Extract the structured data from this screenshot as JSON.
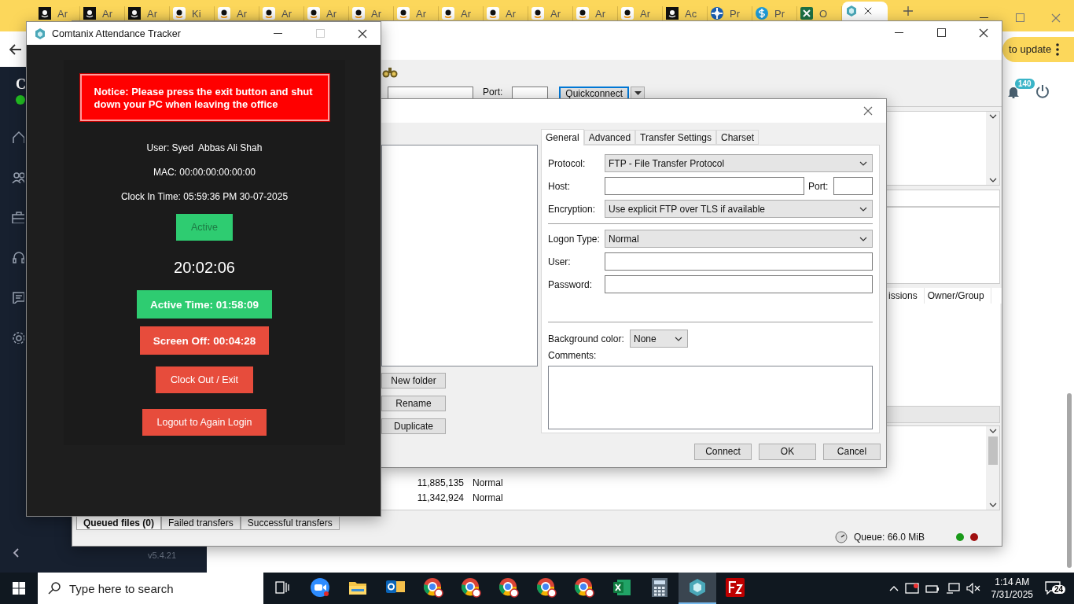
{
  "browser": {
    "tabs": [
      {
        "kind": "dark",
        "title": "Ar",
        "selected": false
      },
      {
        "kind": "dark",
        "title": "Ar",
        "selected": false
      },
      {
        "kind": "dark",
        "title": "Ar",
        "selected": false
      },
      {
        "kind": "light",
        "title": "Ki",
        "selected": false
      },
      {
        "kind": "light",
        "title": "Ar",
        "selected": false
      },
      {
        "kind": "light",
        "title": "Ar",
        "selected": false
      },
      {
        "kind": "light",
        "title": "Ar",
        "selected": false
      },
      {
        "kind": "light",
        "title": "Ar",
        "selected": false
      },
      {
        "kind": "light",
        "title": "Ar",
        "selected": false
      },
      {
        "kind": "light",
        "title": "Ar",
        "selected": false
      },
      {
        "kind": "light",
        "title": "Ar",
        "selected": false
      },
      {
        "kind": "light",
        "title": "Ar",
        "selected": false
      },
      {
        "kind": "light",
        "title": "Ar",
        "selected": false
      },
      {
        "kind": "light",
        "title": "Ar",
        "selected": false
      },
      {
        "kind": "dark",
        "title": "Ac",
        "selected": false
      },
      {
        "kind": "wheel",
        "title": "Pr",
        "selected": false
      },
      {
        "kind": "dollar",
        "title": "Pr",
        "selected": false
      },
      {
        "kind": "sheet",
        "title": "O",
        "selected": false
      },
      {
        "kind": "hex",
        "selected": true
      }
    ],
    "update_pill": "to update"
  },
  "webapp": {
    "brand": "C",
    "online": true,
    "nav": [
      {
        "kind": "home"
      },
      {
        "kind": "users"
      },
      {
        "kind": "briefcase"
      },
      {
        "kind": "headset"
      },
      {
        "kind": "message"
      },
      {
        "kind": "settings"
      }
    ],
    "notification_count": "140",
    "version": "v5.4.21"
  },
  "filezilla": {
    "quickconnect": {
      "port_label": "Port:",
      "button": "Quickconnect"
    },
    "columns": [
      "issions",
      "Owner/Group"
    ],
    "queue_rows": [
      {
        "size": "11,885,135",
        "priority": "Normal"
      },
      {
        "size": "11,342,924",
        "priority": "Normal"
      }
    ],
    "tabs": [
      {
        "label": "Queued files (0)",
        "selected": true
      },
      {
        "label": "Failed transfers",
        "selected": false
      },
      {
        "label": "Successful transfers",
        "selected": false
      }
    ],
    "status": {
      "queue": "Queue: 66.0 MiB"
    }
  },
  "site_manager": {
    "side_buttons": [
      "New folder",
      "Rename",
      "Duplicate"
    ],
    "tabs": [
      {
        "label": "General",
        "selected": true
      },
      {
        "label": "Advanced",
        "selected": false
      },
      {
        "label": "Transfer Settings",
        "selected": false
      },
      {
        "label": "Charset",
        "selected": false
      }
    ],
    "protocol": {
      "label": "Protocol:",
      "value": "FTP - File Transfer Protocol"
    },
    "host": {
      "label": "Host:",
      "port_label": "Port:"
    },
    "encryption": {
      "label": "Encryption:",
      "value": "Use explicit FTP over TLS if available"
    },
    "logon_type": {
      "label": "Logon Type:",
      "value": "Normal"
    },
    "user": {
      "label": "User:"
    },
    "password": {
      "label": "Password:"
    },
    "background_color": {
      "label": "Background color:",
      "value": "None"
    },
    "comments": {
      "label": "Comments:"
    },
    "buttons": [
      "Connect",
      "OK",
      "Cancel"
    ]
  },
  "tracker": {
    "title": "Comtanix Attendance Tracker",
    "notice": "Notice: Please press the exit button and shut down your PC when leaving the office",
    "info": [
      "User: Syed  Abbas Ali Shah",
      "MAC: 00:00:00:00:00:00",
      "Clock In Time: 05:59:36 PM 30-07-2025"
    ],
    "status": "Active",
    "clock": "20:02:06",
    "counters": [
      {
        "label": "Active Time: 01:58:09",
        "kind": "good"
      },
      {
        "label": "Screen Off: 00:04:28",
        "kind": "bad"
      }
    ],
    "buttons": [
      "Clock Out / Exit",
      "Logout to Again Login"
    ]
  },
  "taskbar": {
    "search_placeholder": "Type here to search",
    "apps": [
      {
        "kind": "zoom",
        "selected": false
      },
      {
        "kind": "folder",
        "selected": false
      },
      {
        "kind": "mail",
        "selected": false
      },
      {
        "kind": "chrome",
        "selected": false
      },
      {
        "kind": "chrome",
        "selected": false
      },
      {
        "kind": "chrome",
        "selected": false
      },
      {
        "kind": "chrome",
        "selected": false
      },
      {
        "kind": "chrome",
        "selected": false
      },
      {
        "kind": "sheet",
        "selected": false
      },
      {
        "kind": "calculator",
        "selected": false
      },
      {
        "kind": "hex",
        "selected": true
      },
      {
        "kind": "ftp",
        "selected": false
      }
    ],
    "time": "1:14 AM",
    "date": "7/31/2025",
    "notifications": "24"
  }
}
